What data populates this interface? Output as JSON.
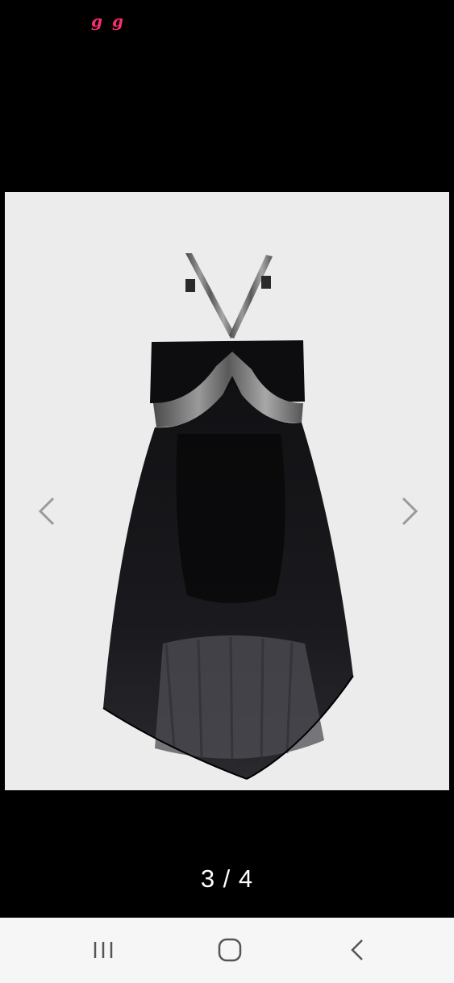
{
  "status_bar": {
    "icons": [
      "g-app-icon",
      "g-app-icon"
    ],
    "icon_glyphs": [
      "g",
      "g"
    ],
    "icon_color": "#ff2d6f"
  },
  "viewer": {
    "image": {
      "subject": "product-photo-dress",
      "background_color": "#ececec"
    },
    "prev_icon": "chevron-left-icon",
    "next_icon": "chevron-right-icon",
    "page_counter": "3 / 4"
  },
  "nav_bar": {
    "recents_icon": "recents-icon",
    "home_icon": "home-icon",
    "back_icon": "back-icon",
    "background_color": "#f6f6f6"
  }
}
